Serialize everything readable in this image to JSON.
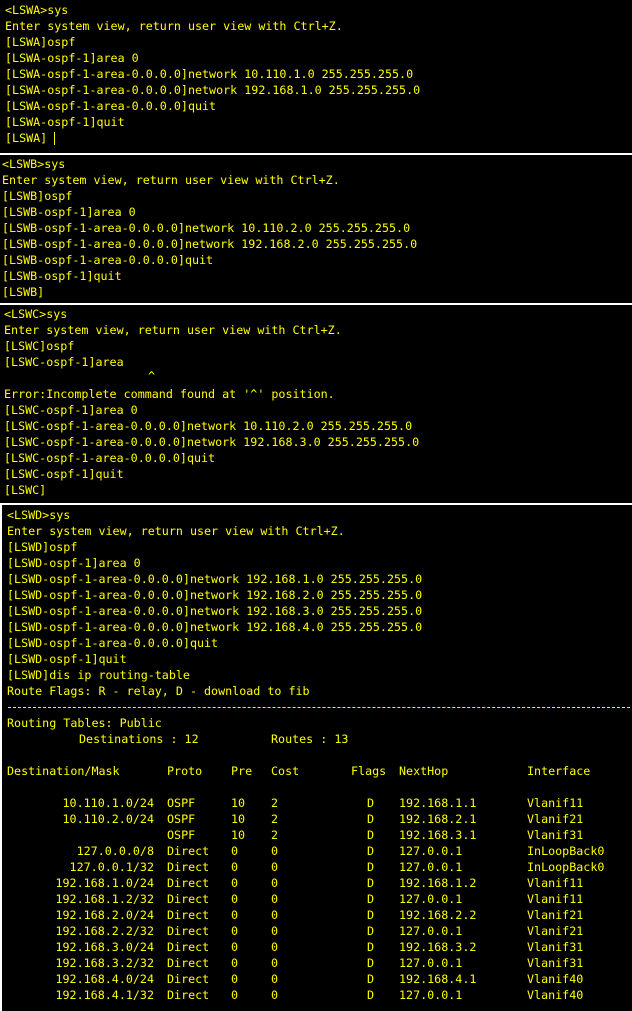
{
  "colors": {
    "background": "#000000",
    "text": "#ffff00",
    "divider": "#ffffff"
  },
  "panels": [
    {
      "id": "lswa",
      "lines": [
        "<LSWA>sys",
        "Enter system view, return user view with Ctrl+Z.",
        "[LSWA]ospf",
        "[LSWA-ospf-1]area 0",
        "[LSWA-ospf-1-area-0.0.0.0]network 10.110.1.0 255.255.255.0",
        "[LSWA-ospf-1-area-0.0.0.0]network 192.168.1.0 255.255.255.0",
        "[LSWA-ospf-1-area-0.0.0.0]quit",
        "[LSWA-ospf-1]quit",
        "[LSWA]"
      ]
    },
    {
      "id": "lswb",
      "lines": [
        "<LSWB>sys",
        "Enter system view, return user view with Ctrl+Z.",
        "[LSWB]ospf",
        "[LSWB-ospf-1]area 0",
        "[LSWB-ospf-1-area-0.0.0.0]network 10.110.2.0 255.255.255.0",
        "[LSWB-ospf-1-area-0.0.0.0]network 192.168.2.0 255.255.255.0",
        "[LSWB-ospf-1-area-0.0.0.0]quit",
        "[LSWB-ospf-1]quit",
        "[LSWB]"
      ]
    },
    {
      "id": "lswc",
      "lines": [
        "<LSWC>sys",
        "Enter system view, return user view with Ctrl+Z.",
        "[LSWC]ospf",
        "[LSWC-ospf-1]area",
        "^",
        "Error:Incomplete command found at '^' position.",
        "[LSWC-ospf-1]area 0",
        "[LSWC-ospf-1-area-0.0.0.0]network 10.110.2.0 255.255.255.0",
        "[LSWC-ospf-1-area-0.0.0.0]network 192.168.3.0 255.255.255.0",
        "[LSWC-ospf-1-area-0.0.0.0]quit",
        "[LSWC-ospf-1]quit",
        "[LSWC]"
      ]
    },
    {
      "id": "lswd",
      "lines": [
        "<LSWD>sys",
        "Enter system view, return user view with Ctrl+Z.",
        "[LSWD]ospf",
        "[LSWD-ospf-1]area 0",
        "[LSWD-ospf-1-area-0.0.0.0]network 192.168.1.0 255.255.255.0",
        "[LSWD-ospf-1-area-0.0.0.0]network 192.168.2.0 255.255.255.0",
        "[LSWD-ospf-1-area-0.0.0.0]network 192.168.3.0 255.255.255.0",
        "[LSWD-ospf-1-area-0.0.0.0]network 192.168.4.0 255.255.255.0",
        "[LSWD-ospf-1-area-0.0.0.0]quit",
        "[LSWD-ospf-1]quit",
        "[LSWD]dis ip routing-table",
        "Route Flags: R - relay, D - download to fib"
      ]
    }
  ],
  "routing": {
    "title": "Routing Tables: Public",
    "destinations_label": "Destinations : 12",
    "routes_label": "Routes : 13",
    "headers": [
      "Destination/Mask",
      "Proto",
      "Pre",
      "Cost",
      "Flags",
      "NextHop",
      "Interface"
    ],
    "rows": [
      [
        "10.110.1.0/24",
        "OSPF",
        "10",
        "2",
        "D",
        "192.168.1.1",
        "Vlanif11"
      ],
      [
        "10.110.2.0/24",
        "OSPF",
        "10",
        "2",
        "D",
        "192.168.2.1",
        "Vlanif21"
      ],
      [
        "",
        "OSPF",
        "10",
        "2",
        "D",
        "192.168.3.1",
        "Vlanif31"
      ],
      [
        "127.0.0.0/8",
        "Direct",
        "0",
        "0",
        "D",
        "127.0.0.1",
        "InLoopBack0"
      ],
      [
        "127.0.0.1/32",
        "Direct",
        "0",
        "0",
        "D",
        "127.0.0.1",
        "InLoopBack0"
      ],
      [
        "192.168.1.0/24",
        "Direct",
        "0",
        "0",
        "D",
        "192.168.1.2",
        "Vlanif11"
      ],
      [
        "192.168.1.2/32",
        "Direct",
        "0",
        "0",
        "D",
        "127.0.0.1",
        "Vlanif11"
      ],
      [
        "192.168.2.0/24",
        "Direct",
        "0",
        "0",
        "D",
        "192.168.2.2",
        "Vlanif21"
      ],
      [
        "192.168.2.2/32",
        "Direct",
        "0",
        "0",
        "D",
        "127.0.0.1",
        "Vlanif21"
      ],
      [
        "192.168.3.0/24",
        "Direct",
        "0",
        "0",
        "D",
        "192.168.3.2",
        "Vlanif31"
      ],
      [
        "192.168.3.2/32",
        "Direct",
        "0",
        "0",
        "D",
        "127.0.0.1",
        "Vlanif31"
      ],
      [
        "192.168.4.0/24",
        "Direct",
        "0",
        "0",
        "D",
        "192.168.4.1",
        "Vlanif40"
      ],
      [
        "192.168.4.1/32",
        "Direct",
        "0",
        "0",
        "D",
        "127.0.0.1",
        "Vlanif40"
      ]
    ]
  }
}
